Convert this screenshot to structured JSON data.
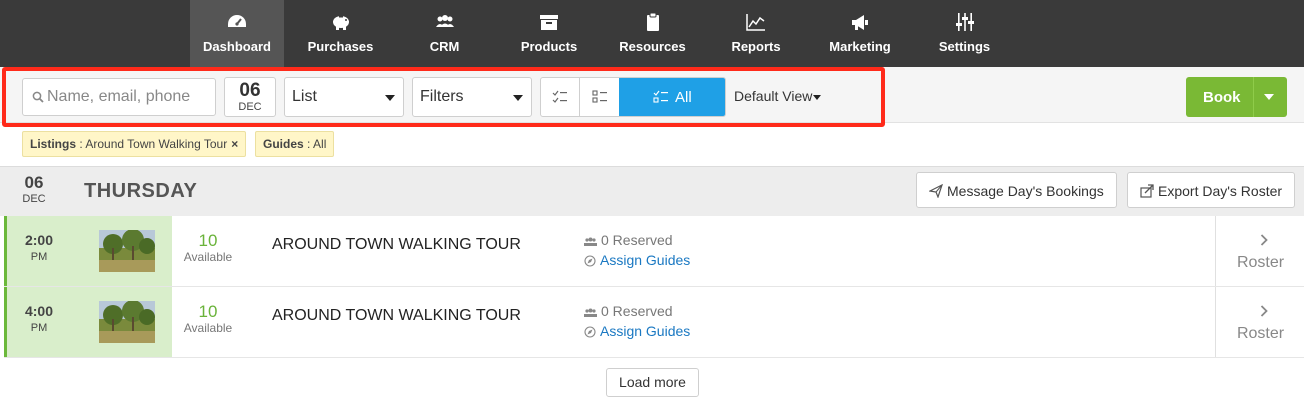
{
  "nav": {
    "items": [
      {
        "label": "Dashboard",
        "icon": "dashboard-icon"
      },
      {
        "label": "Purchases",
        "icon": "piggy-bank-icon"
      },
      {
        "label": "CRM",
        "icon": "users-icon"
      },
      {
        "label": "Products",
        "icon": "archive-icon"
      },
      {
        "label": "Resources",
        "icon": "clipboard-icon"
      },
      {
        "label": "Reports",
        "icon": "line-chart-icon"
      },
      {
        "label": "Marketing",
        "icon": "megaphone-icon"
      },
      {
        "label": "Settings",
        "icon": "sliders-icon"
      }
    ],
    "active": "Dashboard"
  },
  "toolbar": {
    "search_placeholder": "Name, email, phone",
    "date_day": "06",
    "date_month": "DEC",
    "view_select": "List",
    "filters_select": "Filters",
    "view_toggle_all": "All",
    "default_view": "Default View",
    "book_label": "Book"
  },
  "chips": [
    {
      "key": "Listings",
      "value": "Around Town Walking Tour",
      "removable": true
    },
    {
      "key": "Guides",
      "value": "All",
      "removable": false
    }
  ],
  "day": {
    "date_day": "06",
    "date_month": "DEC",
    "weekday": "THURSDAY",
    "message_button": "Message Day's Bookings",
    "export_button": "Export Day's Roster"
  },
  "rows": [
    {
      "time": "2:00",
      "period": "PM",
      "available": "10",
      "available_label": "Available",
      "title": "AROUND TOWN WALKING TOUR",
      "reserved": "0 Reserved",
      "assign": "Assign Guides",
      "roster": "Roster"
    },
    {
      "time": "4:00",
      "period": "PM",
      "available": "10",
      "available_label": "Available",
      "title": "AROUND TOWN WALKING TOUR",
      "reserved": "0 Reserved",
      "assign": "Assign Guides",
      "roster": "Roster"
    }
  ],
  "load_more": "Load more",
  "colors": {
    "nav_bg": "#3a3a3a",
    "accent_blue": "#1fa0e6",
    "book_green": "#7ab935",
    "available_green": "#6ab33a",
    "row_time_bg": "#d9eecb",
    "link_blue": "#1a78c2",
    "highlight_red": "#ff2a1a"
  }
}
